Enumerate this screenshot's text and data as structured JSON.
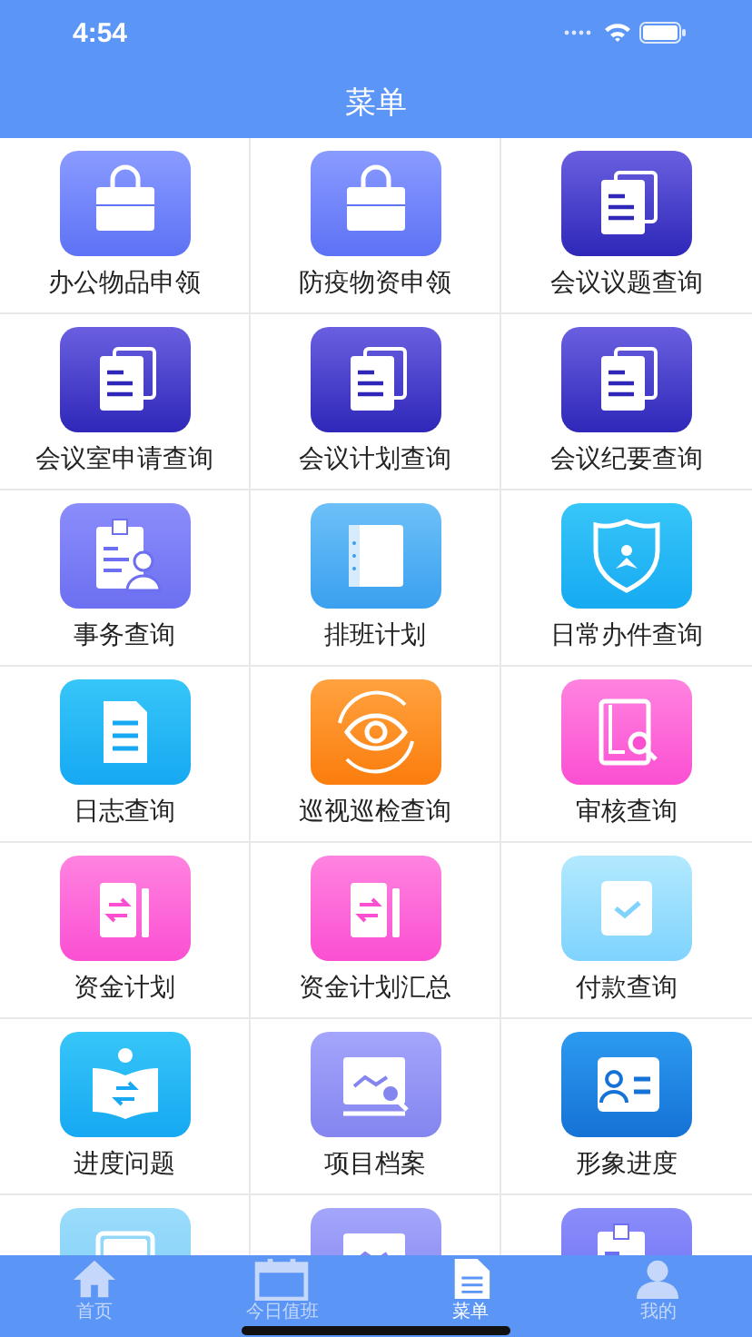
{
  "status_bar": {
    "time": "4:54"
  },
  "nav_bar": {
    "title": "菜单"
  },
  "menu_items": [
    {
      "label": "办公物品申领",
      "kind": "briefcase"
    },
    {
      "label": "防疫物资申领",
      "kind": "briefcase"
    },
    {
      "label": "会议议题查询",
      "kind": "documents"
    },
    {
      "label": "会议室申请查询",
      "kind": "documents"
    },
    {
      "label": "会议计划查询",
      "kind": "documents"
    },
    {
      "label": "会议纪要查询",
      "kind": "documents"
    },
    {
      "label": "事务查询",
      "kind": "badge"
    },
    {
      "label": "排班计划",
      "kind": "notebook"
    },
    {
      "label": "日常办件查询",
      "kind": "shield"
    },
    {
      "label": "日志查询",
      "kind": "file"
    },
    {
      "label": "巡视巡检查询",
      "kind": "eye"
    },
    {
      "label": "审核查询",
      "kind": "booksearch"
    },
    {
      "label": "资金计划",
      "kind": "transfer"
    },
    {
      "label": "资金计划汇总",
      "kind": "transfer"
    },
    {
      "label": "付款查询",
      "kind": "check"
    },
    {
      "label": "进度问题",
      "kind": "bookswap"
    },
    {
      "label": "项目档案",
      "kind": "chart"
    },
    {
      "label": "形象进度",
      "kind": "contact"
    },
    {
      "kind": "folder"
    },
    {
      "kind": "chart"
    },
    {
      "kind": "badge"
    }
  ],
  "tab_bar": [
    {
      "label": "首页",
      "kind": "home",
      "selected": false
    },
    {
      "label": "今日值班",
      "kind": "calendar",
      "selected": false
    },
    {
      "label": "菜单",
      "kind": "document",
      "selected": true
    },
    {
      "label": "我的",
      "kind": "person",
      "selected": false
    }
  ]
}
